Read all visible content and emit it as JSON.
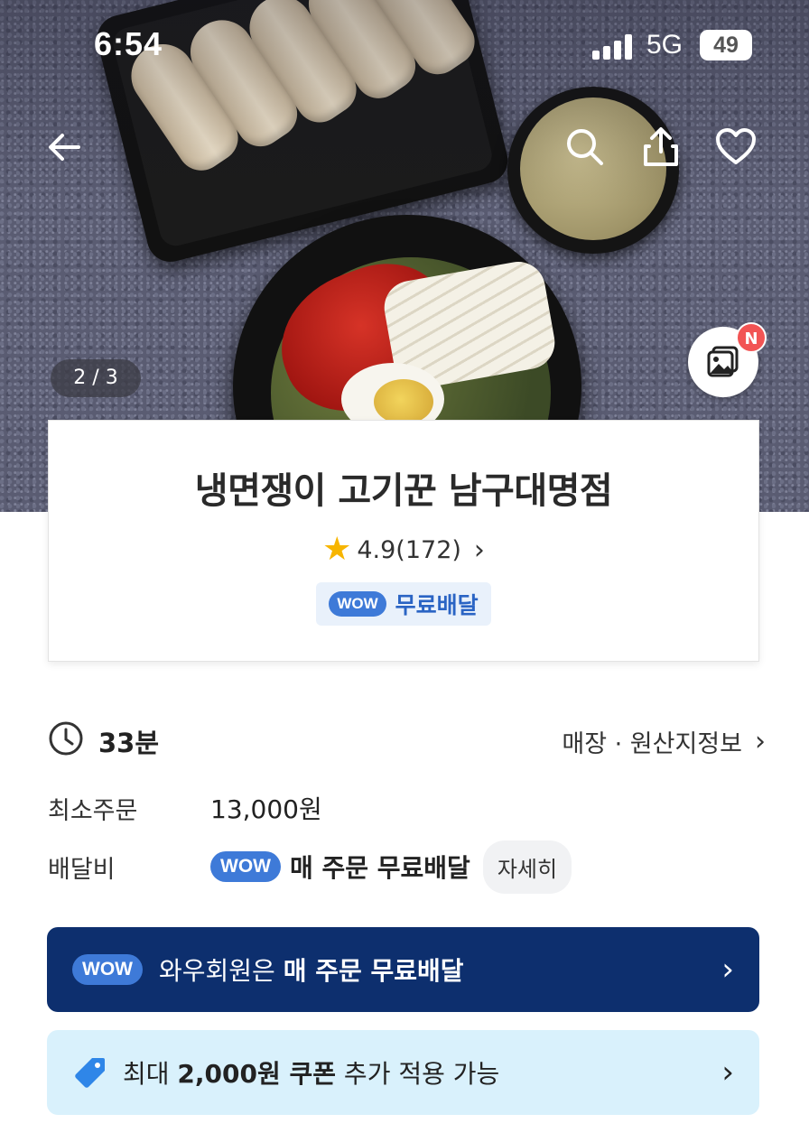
{
  "status_bar": {
    "time": "6:54",
    "network": "5G",
    "battery": "49"
  },
  "gallery": {
    "counter": "2 / 3",
    "new_badge": "N"
  },
  "store": {
    "name": "냉면쟁이 고기꾼 남구대명점",
    "rating": "4.9(172)",
    "wow_label": "WOW",
    "free_delivery": "무료배달"
  },
  "info": {
    "eta": "33분",
    "store_origin_link": "매장 · 원산지정보",
    "min_order_label": "최소주문",
    "min_order_value": "13,000원",
    "delivery_fee_label": "배달비",
    "delivery_fee_wow": "WOW",
    "delivery_fee_text": "매 주문 무료배달",
    "detail_button": "자세히"
  },
  "banners": {
    "wow": {
      "badge": "WOW",
      "text_prefix": "와우회원은 ",
      "text_bold": "매 주문 무료배달"
    },
    "coupon": {
      "prefix": "최대 ",
      "amount": "2,000원 쿠폰",
      "suffix": " 추가 적용 가능"
    }
  },
  "icons": [
    "back-arrow-icon",
    "search-icon",
    "share-icon",
    "heart-icon",
    "photo-album-icon",
    "star-icon",
    "clock-icon",
    "chevron-right-icon",
    "tag-icon"
  ],
  "colors": {
    "wow_blue": "#3e7ad8",
    "banner_navy": "#0d2f6e",
    "coupon_bg": "#d9f1fc",
    "star": "#f7b500",
    "badge_red": "#f25454"
  }
}
